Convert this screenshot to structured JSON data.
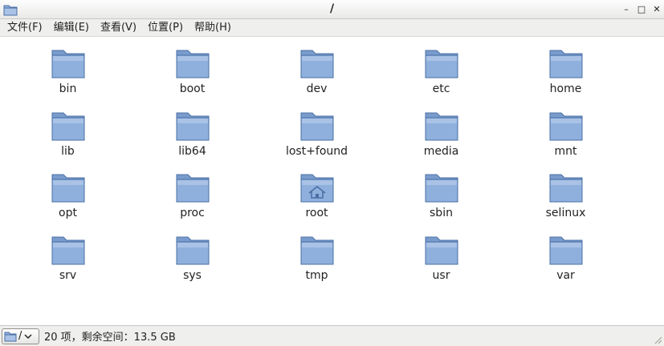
{
  "window": {
    "title": "/",
    "app_icon": "folder-icon",
    "controls": [
      "minimize-icon",
      "maximize-icon",
      "close-icon"
    ],
    "minimize_glyph": "–",
    "maximize_glyph": "□",
    "close_glyph": "✕"
  },
  "menu": {
    "items": [
      {
        "label": "文件(F)"
      },
      {
        "label": "编辑(E)"
      },
      {
        "label": "查看(V)"
      },
      {
        "label": "位置(P)"
      },
      {
        "label": "帮助(H)"
      }
    ]
  },
  "files": [
    {
      "name": "bin",
      "icon": "folder-icon"
    },
    {
      "name": "boot",
      "icon": "folder-icon"
    },
    {
      "name": "dev",
      "icon": "folder-icon"
    },
    {
      "name": "etc",
      "icon": "folder-icon"
    },
    {
      "name": "home",
      "icon": "folder-icon"
    },
    {
      "name": "lib",
      "icon": "folder-icon"
    },
    {
      "name": "lib64",
      "icon": "folder-icon"
    },
    {
      "name": "lost+found",
      "icon": "folder-icon"
    },
    {
      "name": "media",
      "icon": "folder-icon"
    },
    {
      "name": "mnt",
      "icon": "folder-icon"
    },
    {
      "name": "opt",
      "icon": "folder-icon"
    },
    {
      "name": "proc",
      "icon": "folder-icon"
    },
    {
      "name": "root",
      "icon": "home-folder-icon"
    },
    {
      "name": "sbin",
      "icon": "folder-icon"
    },
    {
      "name": "selinux",
      "icon": "folder-icon"
    },
    {
      "name": "srv",
      "icon": "folder-icon"
    },
    {
      "name": "sys",
      "icon": "folder-icon"
    },
    {
      "name": "tmp",
      "icon": "folder-icon"
    },
    {
      "name": "usr",
      "icon": "folder-icon"
    },
    {
      "name": "var",
      "icon": "folder-icon"
    }
  ],
  "statusbar": {
    "path_label": "/",
    "status_text": "20 项，剩余空间：13.5 GB"
  },
  "colors": {
    "folder_fill": "#8fb0dc",
    "folder_edge": "#4a6fa5",
    "folder_tab": "#7a9ccd"
  }
}
